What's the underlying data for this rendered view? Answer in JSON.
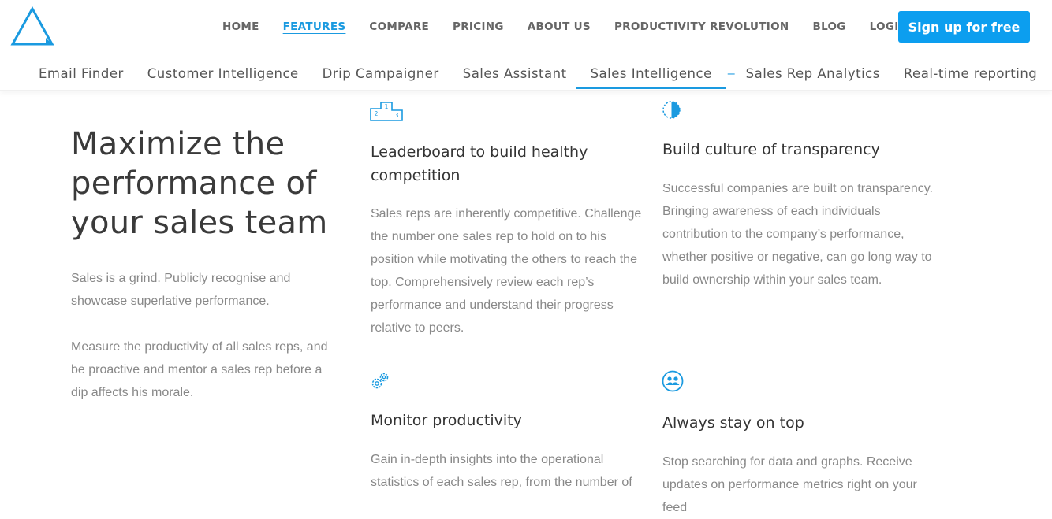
{
  "brand": {
    "accent": "#0c9eef",
    "logo_icon": "triangle-logo-icon"
  },
  "topnav": {
    "items": [
      {
        "label": "HOME",
        "active": false
      },
      {
        "label": "FEATURES",
        "active": true
      },
      {
        "label": "COMPARE",
        "active": false
      },
      {
        "label": "PRICING",
        "active": false
      },
      {
        "label": "ABOUT US",
        "active": false
      },
      {
        "label": "PRODUCTIVITY REVOLUTION",
        "active": false
      },
      {
        "label": "BLOG",
        "active": false
      },
      {
        "label": "LOGIN",
        "active": false
      }
    ],
    "signup_label": "Sign up for free"
  },
  "subnav": {
    "items": [
      {
        "label": "Email Finder"
      },
      {
        "label": "Customer Intelligence"
      },
      {
        "label": "Drip Campaigner"
      },
      {
        "label": "Sales Assistant"
      },
      {
        "label": "Sales Intelligence",
        "active": true
      },
      {
        "label": "Sales Rep Analytics"
      },
      {
        "label": "Real-time reporting"
      }
    ],
    "separator": "–"
  },
  "hero": {
    "title": "Maximize the performance of your sales team",
    "paragraphs": [
      "Sales is a grind. Publicly recognise and showcase superlative performance.",
      "Measure the productivity of all sales reps, and be proactive and mentor a sales rep before a dip affects his morale."
    ]
  },
  "features": [
    {
      "icon": "podium-icon",
      "podium_numbers": [
        "1",
        "2",
        "3"
      ],
      "title": "Leaderboard to build healthy competition",
      "text": "Sales reps are inherently competitive. Challenge the number one sales rep to hold on to his position while motivating the others to reach the top. Comprehensively review each rep’s performance and understand their progress relative to peers."
    },
    {
      "icon": "half-circle-icon",
      "title": "Build culture of transparency",
      "text": "Successful companies are built on transparency. Bringing awareness of each individuals contribution to the company’s performance, whether positive or negative, can go long way to build ownership within your sales team."
    },
    {
      "icon": "gears-icon",
      "title": "Monitor productivity",
      "text": "Gain in-depth insights into the operational statistics of each sales rep, from the number of"
    },
    {
      "icon": "team-icon",
      "title": "Always stay on top",
      "text": "Stop searching for data and graphs. Receive updates on performance metrics right on your feed"
    }
  ]
}
